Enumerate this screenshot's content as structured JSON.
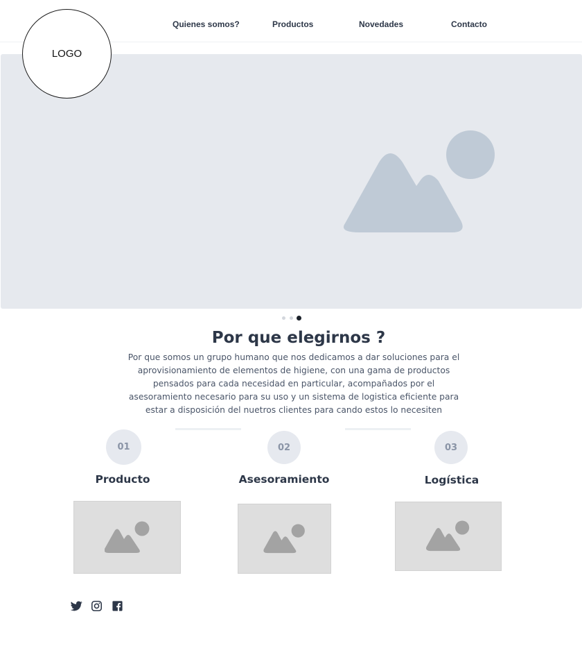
{
  "logo": {
    "text": "LOGO"
  },
  "nav": {
    "items": [
      {
        "label": "Quienes somos?"
      },
      {
        "label": "Productos"
      },
      {
        "label": "Novedades"
      },
      {
        "label": "Contacto"
      }
    ]
  },
  "hero": {
    "icon": "image-placeholder-icon",
    "slide_count": 3,
    "active_slide": 3
  },
  "why": {
    "title": "Por que elegirnos ?",
    "description": "Por que somos un grupo humano que nos dedicamos a dar soluciones para el aprovisionamiento de elementos de higiene, con una gama de productos pensados para cada necesidad en particular, acompañados por el asesoramiento necesario para su uso y un sistema de logistica eficiente para estar a disposición del nuetros clientes para cando estos lo necesiten"
  },
  "steps": [
    {
      "number": "01",
      "title": "Producto"
    },
    {
      "number": "02",
      "title": "Asesoramiento"
    },
    {
      "number": "03",
      "title": "Logística"
    }
  ],
  "social": [
    {
      "icon": "twitter-icon"
    },
    {
      "icon": "instagram-icon"
    },
    {
      "icon": "facebook-icon"
    }
  ],
  "colors": {
    "text": "#2d3748",
    "muted_text": "#4a5568",
    "hero_bg": "#e6e9ee",
    "hero_icon": "#bfcad6",
    "thumb_bg": "#dedede",
    "thumb_icon": "#a3a3a3",
    "step_circle": "#e6e9ef"
  }
}
